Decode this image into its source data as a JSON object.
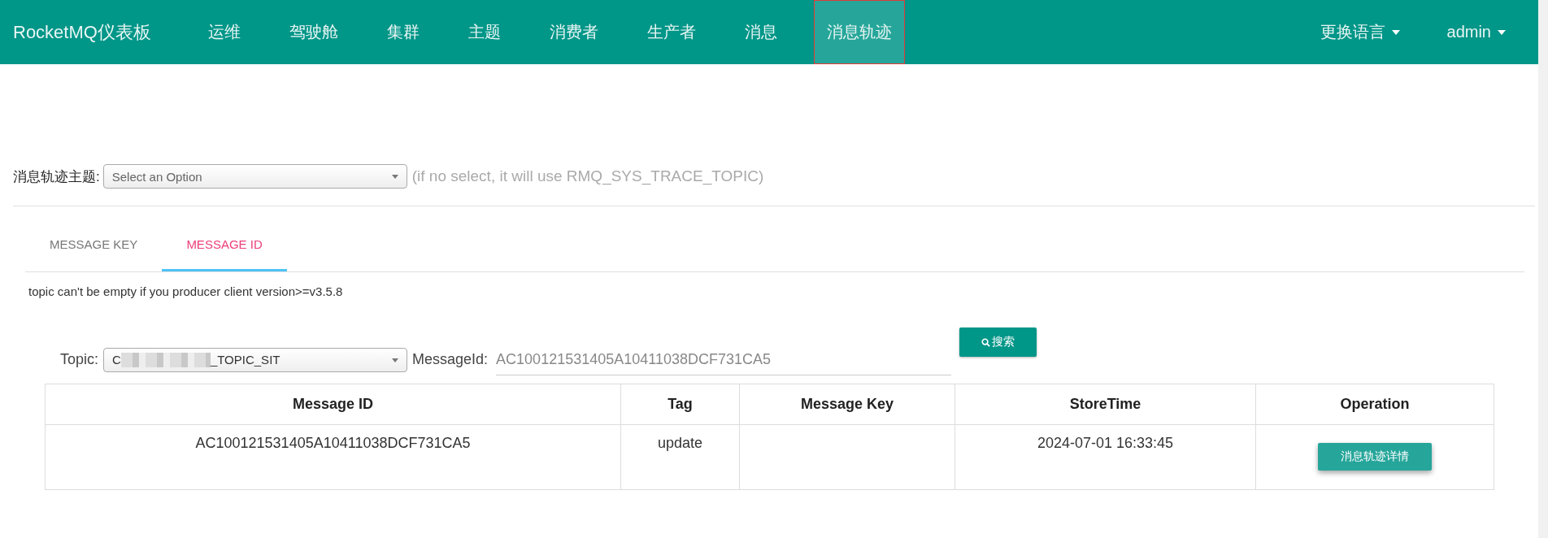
{
  "navbar": {
    "brand": "RocketMQ仪表板",
    "items": [
      {
        "label": "运维",
        "selected": false
      },
      {
        "label": "驾驶舱",
        "selected": false
      },
      {
        "label": "集群",
        "selected": false
      },
      {
        "label": "主题",
        "selected": false
      },
      {
        "label": "消费者",
        "selected": false
      },
      {
        "label": "生产者",
        "selected": false
      },
      {
        "label": "消息",
        "selected": false
      },
      {
        "label": "消息轨迹",
        "selected": true
      }
    ],
    "language_menu": "更换语言",
    "user_menu": "admin"
  },
  "trace_topic": {
    "label": "消息轨迹主题:",
    "placeholder": "Select an Option",
    "hint": "(if no select, it will use RMQ_SYS_TRACE_TOPIC)"
  },
  "tabs": [
    {
      "label": "MESSAGE KEY",
      "selected": false
    },
    {
      "label": "MESSAGE ID",
      "selected": true
    }
  ],
  "notice": "topic can't be empty if you producer client version>=v3.5.8",
  "search": {
    "topic_label": "Topic:",
    "topic_value_start": "C",
    "topic_value_end": "_TOPIC_SIT",
    "message_id_label": "MessageId:",
    "message_id_value": "AC100121531405A10411038DCF731CA5",
    "button": "搜索"
  },
  "table": {
    "columns": [
      "Message ID",
      "Tag",
      "Message Key",
      "StoreTime",
      "Operation"
    ],
    "rows": [
      {
        "message_id": "AC100121531405A10411038DCF731CA5",
        "tag": "update",
        "message_key": "",
        "store_time": "2024-07-01 16:33:45",
        "action": "消息轨迹详情"
      }
    ]
  }
}
